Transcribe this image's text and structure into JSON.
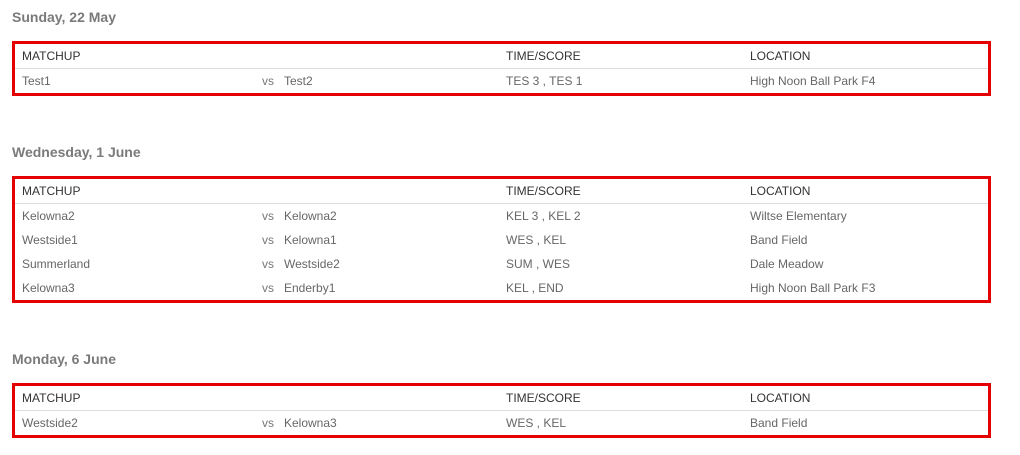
{
  "columns": {
    "matchup": "MATCHUP",
    "time_score": "TIME/SCORE",
    "location": "LOCATION"
  },
  "vs_label": "vs",
  "days": [
    {
      "date": "Sunday, 22 May",
      "games": [
        {
          "home": "Test1",
          "away": "Test2",
          "score": "TES 3 , TES 1",
          "location": "High Noon Ball Park F4"
        }
      ]
    },
    {
      "date": "Wednesday, 1 June",
      "games": [
        {
          "home": "Kelowna2",
          "away": "Kelowna2",
          "score": "KEL 3 , KEL 2",
          "location": "Wiltse Elementary"
        },
        {
          "home": "Westside1",
          "away": "Kelowna1",
          "score": "WES , KEL",
          "location": "Band Field"
        },
        {
          "home": "Summerland",
          "away": "Westside2",
          "score": "SUM , WES",
          "location": "Dale Meadow"
        },
        {
          "home": "Kelowna3",
          "away": "Enderby1",
          "score": "KEL , END",
          "location": "High Noon Ball Park F3"
        }
      ]
    },
    {
      "date": "Monday, 6 June",
      "games": [
        {
          "home": "Westside2",
          "away": "Kelowna3",
          "score": "WES , KEL",
          "location": "Band Field"
        }
      ]
    }
  ],
  "colors": {
    "highlight_border": "#e50000",
    "heading": "#7a7a7a"
  }
}
